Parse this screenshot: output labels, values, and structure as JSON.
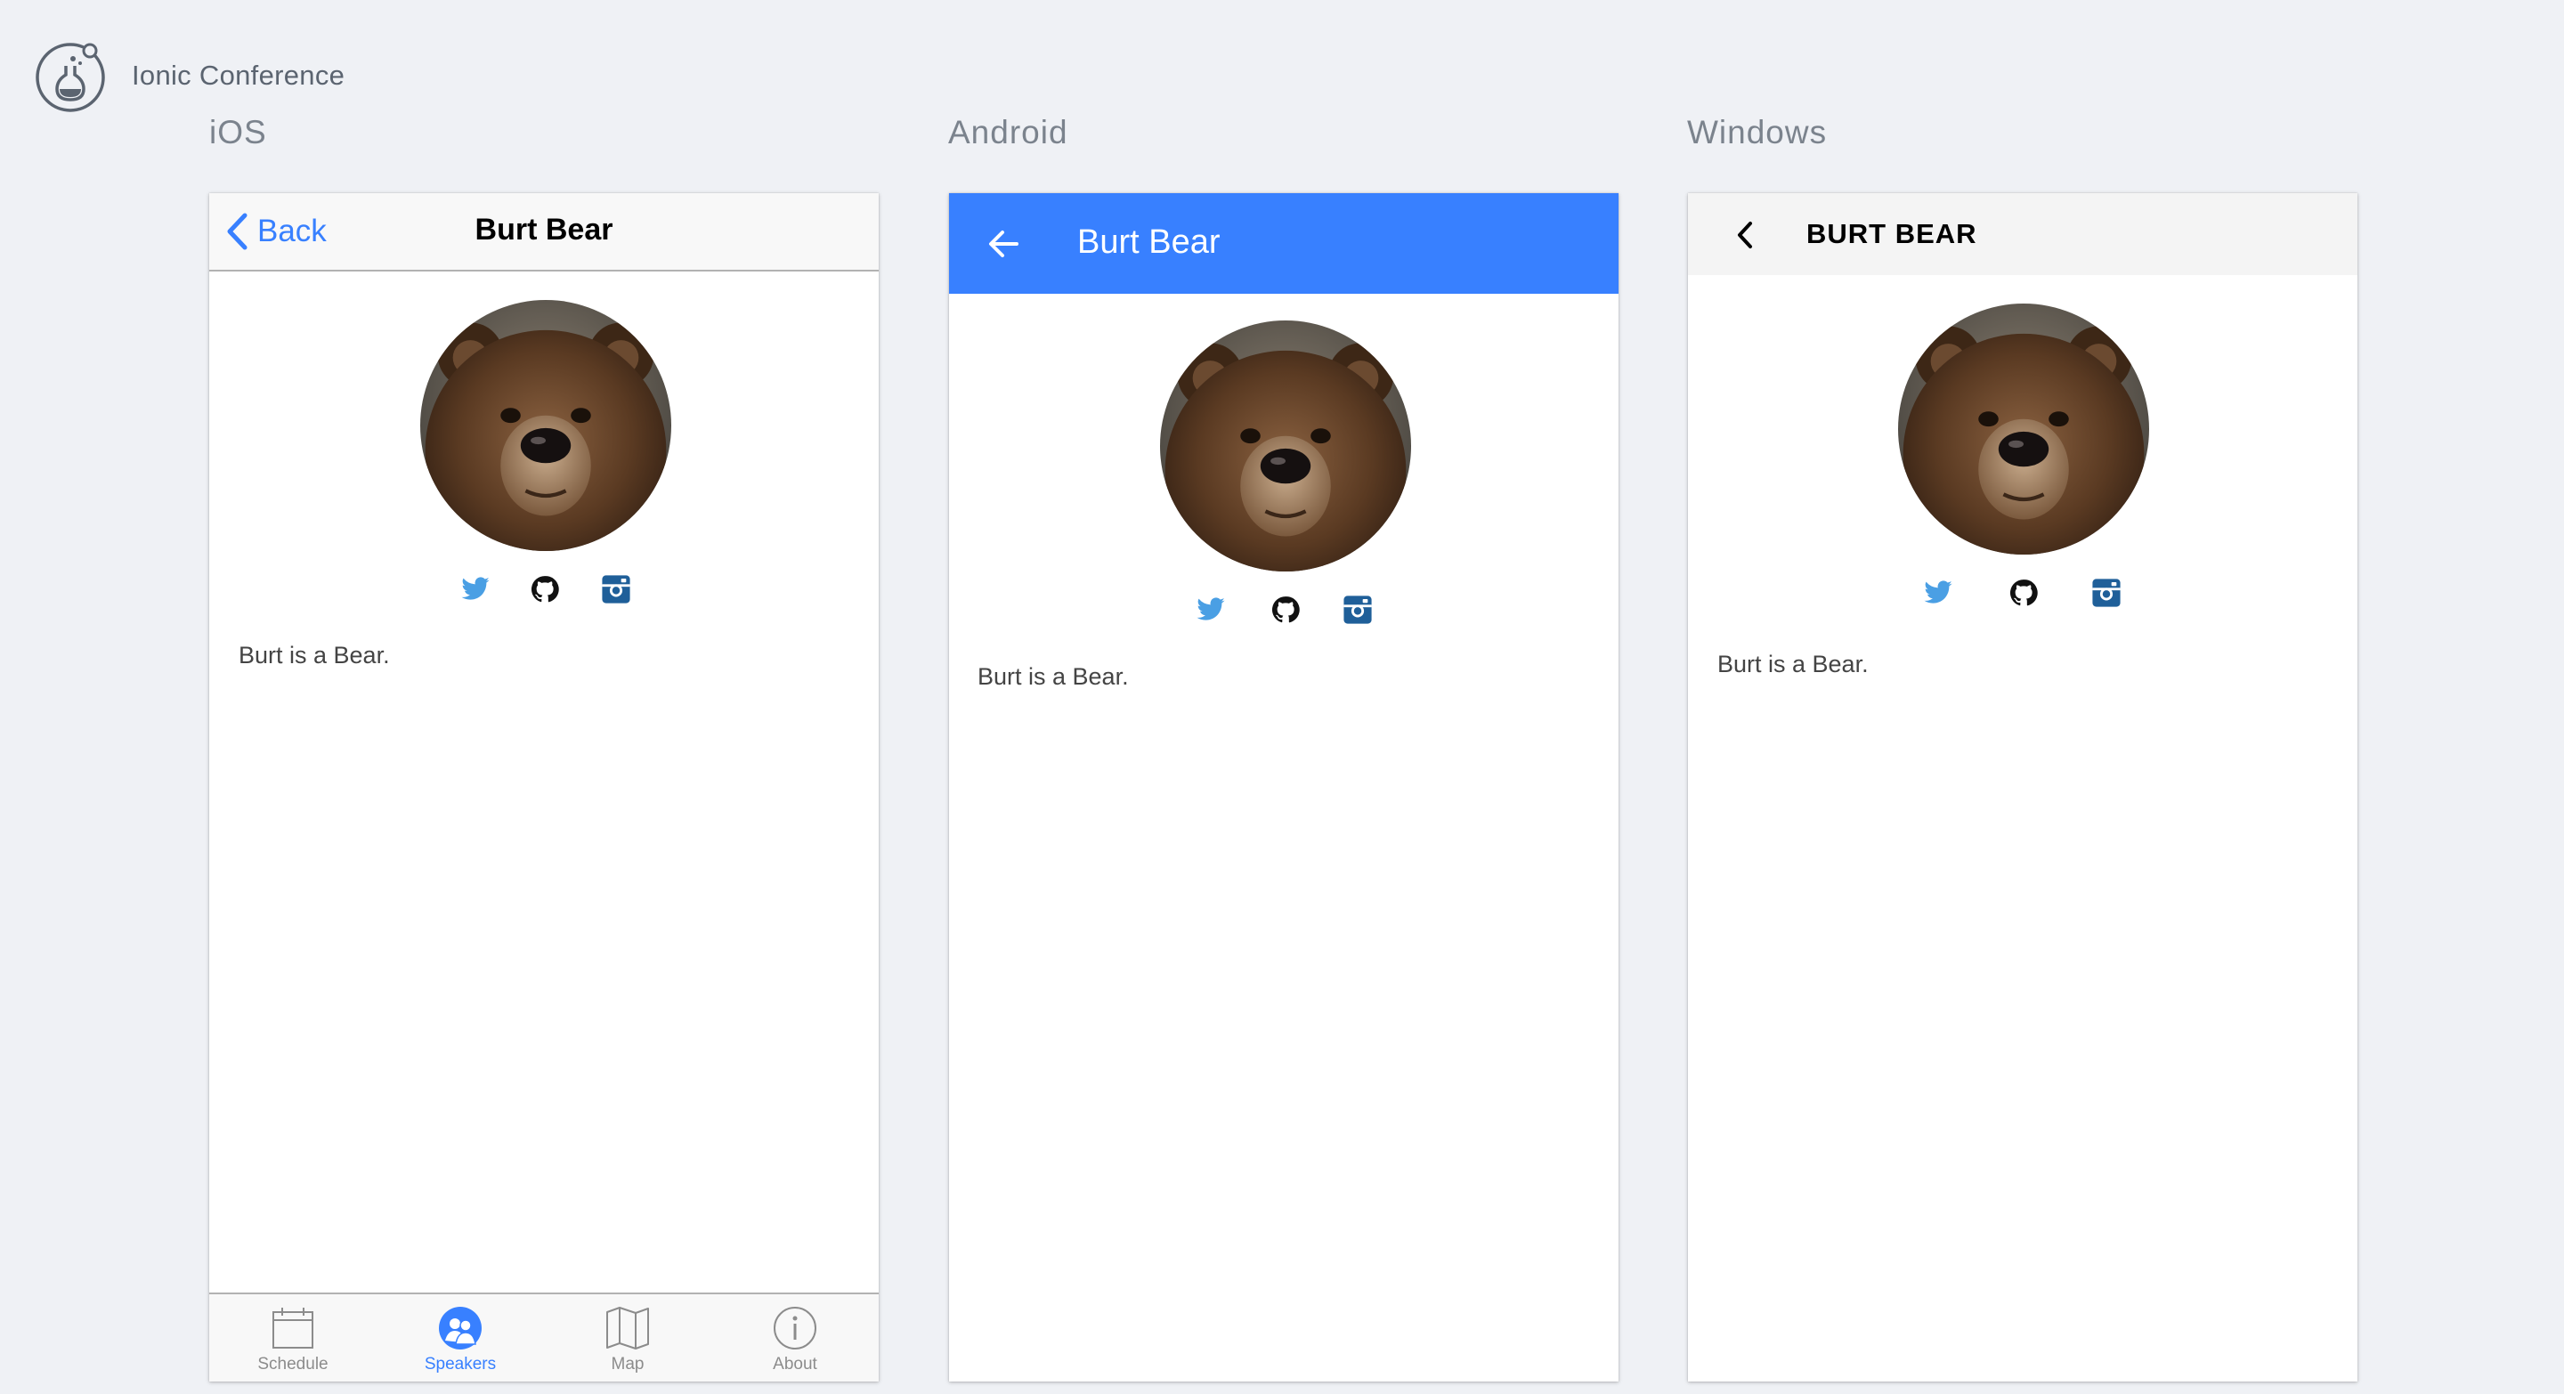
{
  "app": {
    "title": "Ionic Conference"
  },
  "platforms": {
    "ios": "iOS",
    "android": "Android",
    "windows": "Windows"
  },
  "speaker": {
    "name": "Burt Bear",
    "name_upper": "BURT BEAR",
    "bio": "Burt is a Bear."
  },
  "ios": {
    "back_label": "Back"
  },
  "tabs": [
    {
      "label": "Schedule",
      "icon": "calendar-icon",
      "active": false
    },
    {
      "label": "Speakers",
      "icon": "contacts-icon",
      "active": true
    },
    {
      "label": "Map",
      "icon": "map-icon",
      "active": false
    },
    {
      "label": "About",
      "icon": "info-icon",
      "active": false
    }
  ],
  "social_icons": [
    "twitter-icon",
    "github-icon",
    "instagram-icon"
  ],
  "colors": {
    "primary": "#3880ff",
    "twitter": "#4a9fe4",
    "instagram": "#1f5f99",
    "background": "#eff1f5"
  }
}
